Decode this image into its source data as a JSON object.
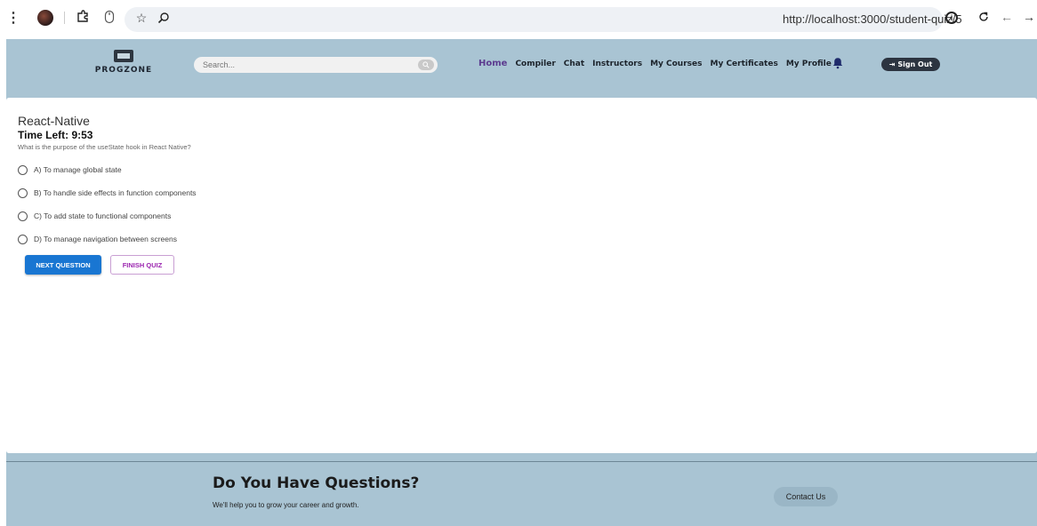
{
  "browser": {
    "url": "http://localhost:3000/student-quiz/5"
  },
  "navbar": {
    "logo_text": "PROGZONE",
    "search_placeholder": "Search...",
    "links": [
      "Home",
      "Compiler",
      "Chat",
      "Instructors",
      "My Courses",
      "My Certificates",
      "My Profile"
    ],
    "signout_label": "Sign Out"
  },
  "quiz": {
    "title": "React-Native",
    "time_left": "Time Left: 9:53",
    "question": "What is the purpose of the useState hook in React Native?",
    "options": [
      "A) To manage global state",
      "B) To handle side effects in function components",
      "C) To add state to functional components",
      "D) To manage navigation between screens"
    ],
    "next_label": "NEXT QUESTION",
    "finish_label": "FINISH QUIZ"
  },
  "footer": {
    "title": "Do You Have Questions?",
    "subtitle": "We'll help you to grow your career and growth.",
    "contact_label": "Contact Us"
  },
  "colors": {
    "brand_bg": "#a9c4d3",
    "primary": "#1976d2",
    "secondary": "#9c27b0",
    "active_link": "#5c3b8f"
  }
}
